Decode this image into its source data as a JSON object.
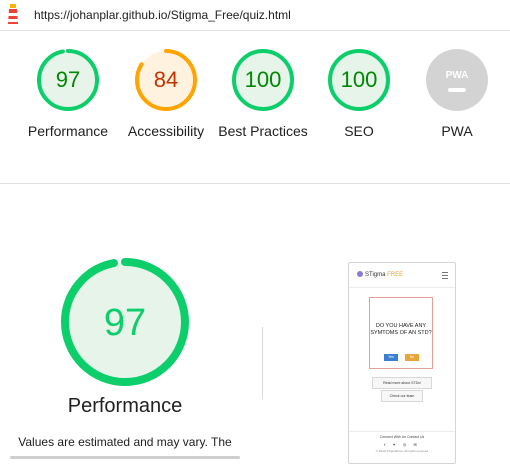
{
  "browser": {
    "url": "https://johanplar.github.io/Stigma_Free/quiz.html"
  },
  "colors": {
    "pass": "#0cce6b",
    "pass_fill": "#e6f4ea",
    "pass_text": "#008800",
    "average": "#ffa400",
    "average_fill": "#fff3e0",
    "average_text": "#c33300",
    "pwa_gray": "#d3d3d3"
  },
  "gauges": [
    {
      "label": "Performance",
      "score": "97",
      "value": 97,
      "rating": "pass"
    },
    {
      "label": "Accessibility",
      "score": "84",
      "value": 84,
      "rating": "average"
    },
    {
      "label": "Best Practices",
      "score": "100",
      "value": 100,
      "rating": "pass"
    },
    {
      "label": "SEO",
      "score": "100",
      "value": 100,
      "rating": "pass"
    },
    {
      "label": "PWA",
      "score": "",
      "badge": "PWA",
      "rating": "na"
    }
  ],
  "detail": {
    "score": "97",
    "value": 97,
    "title": "Performance",
    "note": "Values are estimated and may vary. The"
  },
  "preview": {
    "brand_prefix": "STigma",
    "brand_suffix": "FREE",
    "question": "DO YOU HAVE ANY SYMTOMS OF AN STD?",
    "yes": "Yes",
    "no": "No",
    "read_more": "Read more about STDs!",
    "team": "Check our team",
    "footer_links": "Connect With Us   Contact Us",
    "footer_icons": "f ✦ ◎   ✉",
    "copyright": "© 2020 STigmaFree. All rights reserved"
  }
}
